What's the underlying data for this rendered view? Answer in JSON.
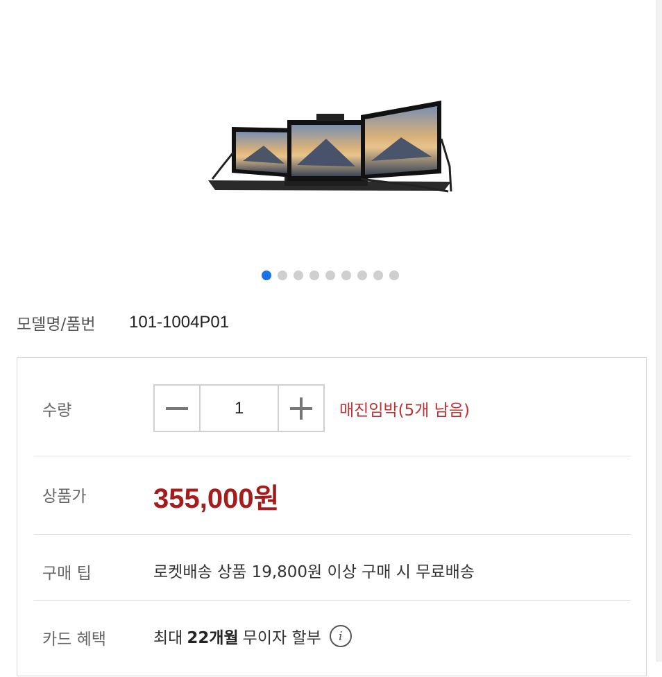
{
  "gallery": {
    "image_name": "triple-portable-monitor-image",
    "total_slides": 9,
    "active_slide": 1
  },
  "product": {
    "model_label": "모델명/품번",
    "model_value": "101-1004P01"
  },
  "quantity": {
    "label": "수량",
    "value": "1",
    "minus_icon": "minus-icon",
    "plus_icon": "plus-icon",
    "stock_note": "매진임박(5개 남음)"
  },
  "price": {
    "label": "상품가",
    "value": "355,000원"
  },
  "tip": {
    "label": "구매 팁",
    "text": "로켓배송 상품 19,800원 이상 구매 시 무료배송"
  },
  "card": {
    "label": "카드 혜택",
    "prefix": "최대",
    "highlight": "22개월",
    "suffix": "무이자 할부",
    "info_icon": "info-icon"
  },
  "colors": {
    "accent_blue": "#1a73e8",
    "price_red": "#a31d1d",
    "stock_red": "#c03232"
  }
}
